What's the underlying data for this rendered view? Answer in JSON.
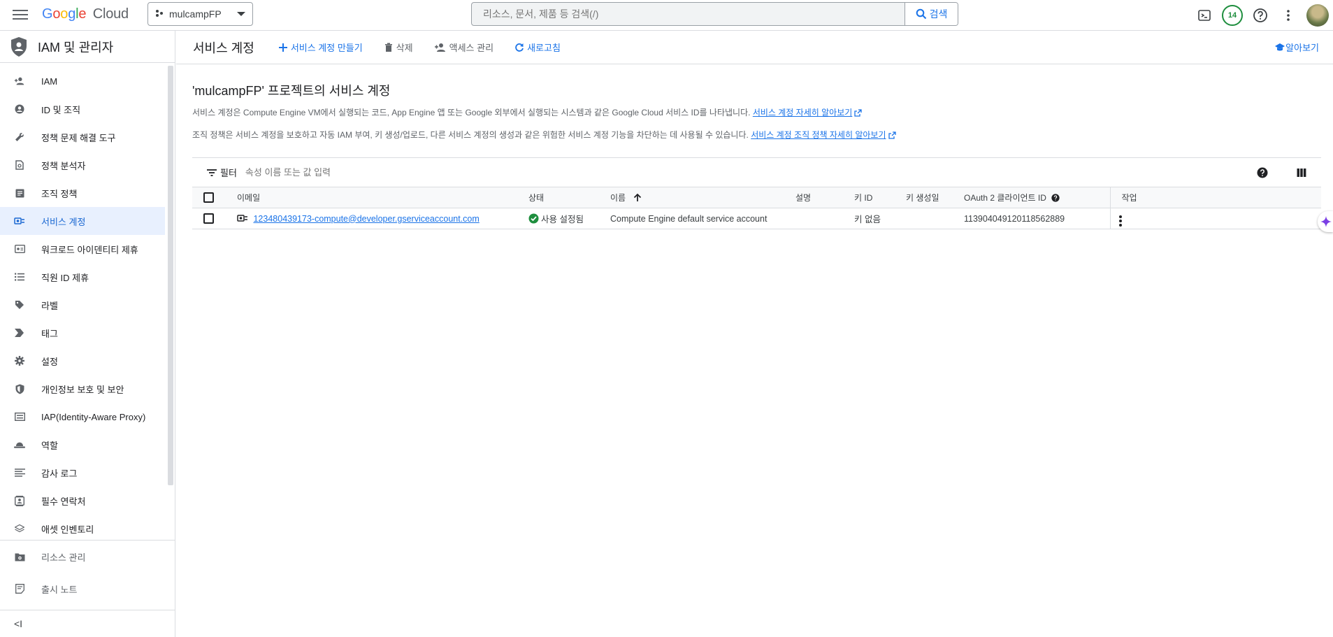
{
  "topbar": {
    "logo_google": "Google",
    "logo_cloud": "Cloud",
    "project_name": "mulcampFP",
    "search_placeholder": "리소스, 문서, 제품 등 검색(/)",
    "search_button": "검색",
    "notification_count": "14"
  },
  "sidebar": {
    "title": "IAM 및 관리자",
    "items": [
      {
        "label": "IAM",
        "icon": "person-add-icon"
      },
      {
        "label": "ID 및 조직",
        "icon": "account-circle-icon"
      },
      {
        "label": "정책 문제 해결 도구",
        "icon": "wrench-icon"
      },
      {
        "label": "정책 분석자",
        "icon": "policy-search-icon"
      },
      {
        "label": "조직 정책",
        "icon": "article-icon"
      },
      {
        "label": "서비스 계정",
        "icon": "service-account-icon"
      },
      {
        "label": "워크로드 아이덴티티 제휴",
        "icon": "badge-icon"
      },
      {
        "label": "직원 ID 제휴",
        "icon": "list-icon"
      },
      {
        "label": "라벨",
        "icon": "label-icon"
      },
      {
        "label": "태그",
        "icon": "tag-icon"
      },
      {
        "label": "설정",
        "icon": "gear-icon"
      },
      {
        "label": "개인정보 보호 및 보안",
        "icon": "shield-icon"
      },
      {
        "label": "IAP(Identity-Aware Proxy)",
        "icon": "proxy-icon"
      },
      {
        "label": "역할",
        "icon": "hat-icon"
      },
      {
        "label": "감사 로그",
        "icon": "log-icon"
      },
      {
        "label": "필수 연락처",
        "icon": "contact-icon"
      },
      {
        "label": "애셋 인벤토리",
        "icon": "inventory-icon"
      }
    ],
    "active_index": 5,
    "bottom_items": [
      {
        "label": "리소스 관리",
        "icon": "folder-gear-icon"
      },
      {
        "label": "출시 노트",
        "icon": "notes-icon"
      }
    ],
    "collapse_label": "<I"
  },
  "toolbar": {
    "page_title": "서비스 계정",
    "create_label": "서비스 계정 만들기",
    "delete_label": "삭제",
    "access_label": "액세스 관리",
    "refresh_label": "새로고침",
    "learn_label": "알아보기"
  },
  "main": {
    "heading": "'mulcampFP' 프로젝트의 서비스 계정",
    "desc1_text": "서비스 계정은 Compute Engine VM에서 실행되는 코드, App Engine 앱 또는 Google 외부에서 실행되는 시스템과 같은 Google Cloud 서비스 ID를 나타냅니다.",
    "desc1_link": "서비스 계정 자세히 알아보기",
    "desc2_text": "조직 정책은 서비스 계정을 보호하고 자동 IAM 부여, 키 생성/업로드, 다른 서비스 계정의 생성과 같은 위험한 서비스 계정 기능을 차단하는 데 사용될 수 있습니다.",
    "desc2_link": "서비스 계정 조직 정책 자세히 알아보기"
  },
  "filter": {
    "label": "필터",
    "placeholder": "속성 이름 또는 값 입력"
  },
  "table": {
    "columns": [
      "이메일",
      "상태",
      "이름",
      "설명",
      "키 ID",
      "키 생성일",
      "OAuth 2 클라이언트 ID",
      "작업"
    ],
    "rows": [
      {
        "email": "123480439173-compute@developer.gserviceaccount.com",
        "status": "사용 설정됨",
        "name": "Compute Engine default service account",
        "description": "",
        "key_id": "키 없음",
        "key_created": "",
        "oauth_client_id": "113904049120118562889"
      }
    ]
  },
  "colors": {
    "accent": "#1a73e8",
    "active_bg": "#e8f0fe",
    "success": "#1e8e3e",
    "border": "#dadce0"
  }
}
